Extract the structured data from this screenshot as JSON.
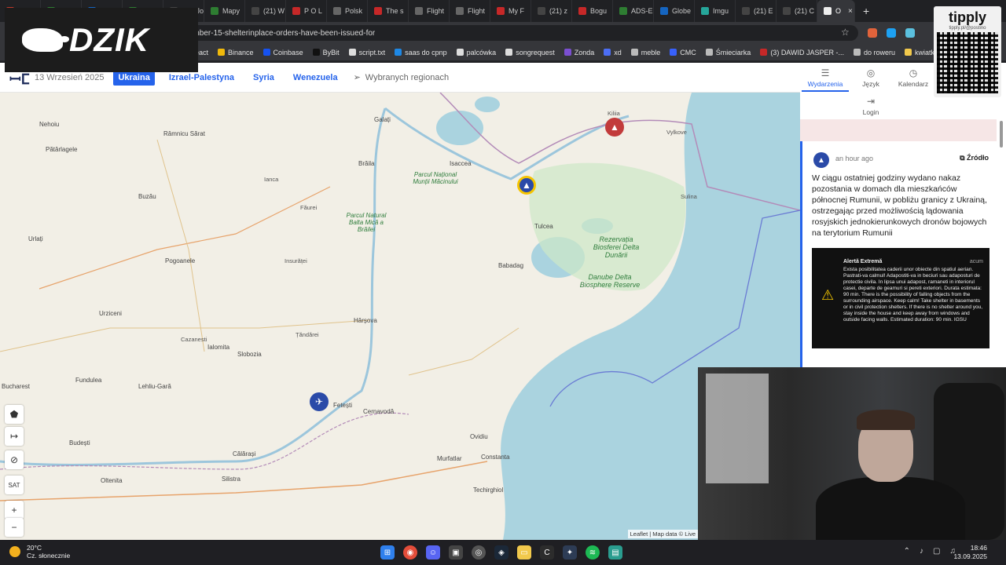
{
  "browser": {
    "tabs": [
      {
        "label": "Futu",
        "color": "#c0392b"
      },
      {
        "label": "Radio",
        "color": "#2e7d32"
      },
      {
        "label": "SBS",
        "color": "#1565c0"
      },
      {
        "label": "Rob",
        "color": "#2e7d32"
      },
      {
        "label": "(21) Jo",
        "color": "#444"
      },
      {
        "label": "Mapy",
        "color": "#2e7d32"
      },
      {
        "label": "(21) W",
        "color": "#444"
      },
      {
        "label": "P O L",
        "color": "#c62828"
      },
      {
        "label": "Polsk",
        "color": "#666"
      },
      {
        "label": "The s",
        "color": "#c62828"
      },
      {
        "label": "Flight",
        "color": "#666"
      },
      {
        "label": "Flight",
        "color": "#666"
      },
      {
        "label": "My F",
        "color": "#c62828"
      },
      {
        "label": "(21) z",
        "color": "#444"
      },
      {
        "label": "Bogu",
        "color": "#c62828"
      },
      {
        "label": "ADS-E",
        "color": "#2e7d32"
      },
      {
        "label": "Globe",
        "color": "#1565c0"
      },
      {
        "label": "Imgu",
        "color": "#26a69a"
      },
      {
        "label": "(21) E",
        "color": "#444"
      },
      {
        "label": "(21) C",
        "color": "#444"
      },
      {
        "label": "O",
        "color": "#eee"
      }
    ],
    "new_tab": "+",
    "url": "eptember-15-shelterinplace-orders-have-been-issued-for"
  },
  "bookmarks": [
    {
      "label": "react",
      "color": "#61dafb"
    },
    {
      "label": "Binance",
      "color": "#f0b90b"
    },
    {
      "label": "Coinbase",
      "color": "#1652f0"
    },
    {
      "label": "ByBit",
      "color": "#111"
    },
    {
      "label": "script.txt",
      "color": "#ddd"
    },
    {
      "label": "saas do cpnp",
      "color": "#1e88e5"
    },
    {
      "label": "palcówka",
      "color": "#ddd"
    },
    {
      "label": "songrequest",
      "color": "#ddd"
    },
    {
      "label": "Zonda",
      "color": "#7b4fd1"
    },
    {
      "label": "xd",
      "color": "#4c6ef5"
    },
    {
      "label": "meble",
      "color": "#bbb"
    },
    {
      "label": "CMC",
      "color": "#3861fb"
    },
    {
      "label": "Śmieciarka",
      "color": "#bbb"
    },
    {
      "label": "(3) DAWID JASPER -...",
      "color": "#c62828"
    },
    {
      "label": "do roweru",
      "color": "#bbb"
    },
    {
      "label": "kwiatki",
      "color": "#f2c94c"
    },
    {
      "label": "Garmin",
      "color": "#1e88e5"
    }
  ],
  "overlays": {
    "brand": "DZIK",
    "tipply_title": "tipply",
    "tipply_url": "tipply.pl/@postino"
  },
  "header": {
    "date": "13 Wrzesień 2025",
    "tabs": [
      "Ukraina",
      "Izrael-Palestyna",
      "Syria",
      "Wenezuela"
    ],
    "region_label": "Wybranych regionach"
  },
  "panel_tabs": [
    {
      "label": "Wydarzenia",
      "icon": "☰"
    },
    {
      "label": "Język",
      "icon": "◎"
    },
    {
      "label": "Kalendarz",
      "icon": "◷"
    },
    {
      "label": "Login",
      "icon": "⇥"
    }
  ],
  "event": {
    "time_ago": "an hour ago",
    "source_label": "Źródło",
    "text": "W ciągu ostatniej godziny wydano nakaz pozostania w domach dla mieszkańców północnej Rumunii, w pobliżu granicy z Ukrainą, ostrzegając przed możliwością lądowania rosyjskich jednokierunkowych dronów bojowych na terytorium Rumunii",
    "alert_title": "Alertă Extremă",
    "alert_time": "acum",
    "alert_text": "Exista posibilitatea caderii unor obiecte din spatiul aerian. Pastrati-va calmul! Adapostiti-va in beciuri sau adaposturi de protectie civila. In lipsa unui adapost, ramaneti in interiorul casei, departe de geamuri si pereti exteriori. Durata estimata: 90 min. There is the possibility of falling objects from the surrounding airspace. Keep calm! Take shelter in basements or in civil protection shelters. If there is no shelter around you, stay inside the house and keep away from windows and outside facing walls. Estimated duration: 90 min. IGSU"
  },
  "map": {
    "labels": [
      {
        "t": "Nehoiu"
      },
      {
        "t": "Râmnicu Sărat"
      },
      {
        "t": "Pătârlagele"
      },
      {
        "t": "Buzău"
      },
      {
        "t": "Urlați"
      },
      {
        "t": "Pogoanele"
      },
      {
        "t": "Urziceni"
      },
      {
        "t": "Slobozia"
      },
      {
        "t": "Ialomita"
      },
      {
        "t": "Lehliu-Gară"
      },
      {
        "t": "Fundulea"
      },
      {
        "t": "Bucharest"
      },
      {
        "t": "Budești"
      },
      {
        "t": "Călărași"
      },
      {
        "t": "Oltenita"
      },
      {
        "t": "Silistra"
      },
      {
        "t": "Galați"
      },
      {
        "t": "Brăila"
      },
      {
        "t": "Isaccea"
      },
      {
        "t": "Tulcea"
      },
      {
        "t": "Babadag"
      },
      {
        "t": "Hârșova"
      },
      {
        "t": "Fetești"
      },
      {
        "t": "Cernavodă"
      },
      {
        "t": "Constanta"
      },
      {
        "t": "Murfatlar"
      },
      {
        "t": "Techirghiol"
      },
      {
        "t": "Ovidiu"
      },
      {
        "t": "Kiliia"
      },
      {
        "t": "Vylkove"
      },
      {
        "t": "Sulina"
      },
      {
        "t": "Insurăței"
      },
      {
        "t": "Țăndărei"
      },
      {
        "t": "Ianca"
      },
      {
        "t": "Făurei"
      },
      {
        "t": "Cazanesti"
      }
    ],
    "park_labels": [
      "Parcul Național Munții Măcinului",
      "Parcul Natural Balta Mică a Brăilei",
      "Rezervația Biosferei Delta Dunării",
      "Danube Delta Biosphere Reserve"
    ],
    "controls": [
      "+",
      "−",
      "SAT"
    ],
    "attribution": "Leaflet | Map data © Live"
  },
  "taskbar": {
    "temp": "20°C",
    "weather": "Cz. słonecznie",
    "time": "18:46",
    "date": "13.09.2025"
  }
}
